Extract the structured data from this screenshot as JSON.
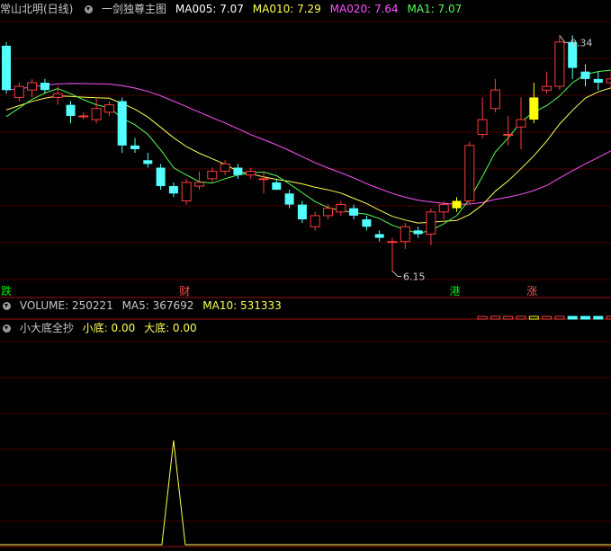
{
  "header": {
    "stock_name": "常山北明(日线)",
    "indicator_name": "一剑独尊主图",
    "ma005": {
      "label": "MA005: 7.07",
      "color": "#ffffff"
    },
    "ma010": {
      "label": "MA010: 7.29",
      "color": "#ffff54"
    },
    "ma020": {
      "label": "MA020: 7.64",
      "color": "#ff54ff"
    },
    "ma1": {
      "label": "MA1: 7.07",
      "color": "#54ff54"
    }
  },
  "volume_header": {
    "volume": "VOLUME: 250221",
    "ma5": "MA5: 367692",
    "ma10": "MA10: 531333"
  },
  "bottom_header": {
    "name": "小大底全抄",
    "small_bottom": "小底: 0.00",
    "big_bottom": "大底: 0.00"
  },
  "chart_data": [
    {
      "type": "candlestick",
      "annotations": [
        {
          "text": "9.34",
          "index": 43,
          "price": 9.34
        },
        {
          "text": "6.15",
          "index": 30,
          "price": 6.15
        }
      ],
      "markers": [
        {
          "text": "跌",
          "index": 0,
          "color": "#00e600"
        },
        {
          "text": "财",
          "index": 14,
          "color": "#ff5050"
        },
        {
          "text": "港",
          "index": 35,
          "color": "#00e600"
        },
        {
          "text": "涨",
          "index": 41,
          "color": "#ff5050"
        }
      ],
      "ohlc": [
        [
          9.2,
          9.25,
          8.55,
          8.6
        ],
        [
          8.5,
          8.7,
          8.45,
          8.65
        ],
        [
          8.6,
          8.75,
          8.5,
          8.7
        ],
        [
          8.7,
          8.75,
          8.55,
          8.6
        ],
        [
          8.5,
          8.65,
          8.4,
          8.55
        ],
        [
          8.4,
          8.45,
          8.15,
          8.25
        ],
        [
          8.25,
          8.3,
          8.2,
          8.25
        ],
        [
          8.2,
          8.5,
          8.15,
          8.35
        ],
        [
          8.3,
          8.45,
          8.25,
          8.4
        ],
        [
          8.45,
          8.5,
          7.75,
          7.85
        ],
        [
          7.85,
          7.95,
          7.75,
          7.8
        ],
        [
          7.65,
          7.75,
          7.55,
          7.6
        ],
        [
          7.55,
          7.6,
          7.25,
          7.3
        ],
        [
          7.3,
          7.35,
          7.15,
          7.2
        ],
        [
          7.1,
          7.4,
          7.05,
          7.35
        ],
        [
          7.3,
          7.5,
          7.25,
          7.35
        ],
        [
          7.4,
          7.55,
          7.35,
          7.5
        ],
        [
          7.5,
          7.65,
          7.45,
          7.6
        ],
        [
          7.55,
          7.6,
          7.4,
          7.45
        ],
        [
          7.45,
          7.55,
          7.4,
          7.5
        ],
        [
          7.4,
          7.5,
          7.2,
          7.4
        ],
        [
          7.35,
          7.4,
          7.25,
          7.25
        ],
        [
          7.2,
          7.25,
          7.0,
          7.05
        ],
        [
          7.05,
          7.1,
          6.8,
          6.85
        ],
        [
          6.75,
          6.95,
          6.7,
          6.9
        ],
        [
          6.9,
          7.05,
          6.85,
          7.0
        ],
        [
          6.95,
          7.1,
          6.9,
          7.05
        ],
        [
          7.0,
          7.05,
          6.85,
          6.9
        ],
        [
          6.85,
          6.9,
          6.7,
          6.75
        ],
        [
          6.65,
          6.7,
          6.55,
          6.6
        ],
        [
          6.55,
          6.6,
          6.15,
          6.55
        ],
        [
          6.55,
          6.8,
          6.45,
          6.75
        ],
        [
          6.7,
          6.75,
          6.6,
          6.65
        ],
        [
          6.65,
          7.0,
          6.5,
          6.95
        ],
        [
          6.95,
          7.1,
          6.85,
          7.05
        ],
        [
          7.0,
          7.15,
          6.95,
          7.1
        ],
        [
          7.1,
          7.9,
          7.05,
          7.85
        ],
        [
          8.0,
          8.5,
          7.95,
          8.2
        ],
        [
          8.35,
          8.75,
          8.3,
          8.6
        ],
        [
          8.0,
          8.25,
          7.85,
          8.0
        ],
        [
          8.1,
          8.5,
          7.8,
          8.2
        ],
        [
          8.2,
          8.7,
          8.15,
          8.5
        ],
        [
          8.6,
          8.85,
          8.55,
          8.65
        ],
        [
          8.65,
          9.34,
          8.6,
          9.25
        ],
        [
          9.25,
          9.34,
          8.75,
          8.9
        ],
        [
          8.85,
          8.95,
          8.65,
          8.75
        ],
        [
          8.75,
          8.85,
          8.6,
          8.7
        ],
        [
          8.7,
          8.85,
          8.6,
          8.75
        ]
      ],
      "series": [
        {
          "name": "MA005",
          "color": "#ffffff"
        },
        {
          "name": "MA010",
          "color": "#ffff54"
        },
        {
          "name": "MA020",
          "color": "#ff54ff"
        },
        {
          "name": "MA1",
          "color": "#54ff54"
        }
      ],
      "yellow_bars": [
        35,
        41
      ],
      "volume_ma5": 367692,
      "volume_ma10": 531333
    },
    {
      "type": "line",
      "name": "小大底全抄",
      "spike_index": 13,
      "values": "all zero except one spike"
    }
  ]
}
